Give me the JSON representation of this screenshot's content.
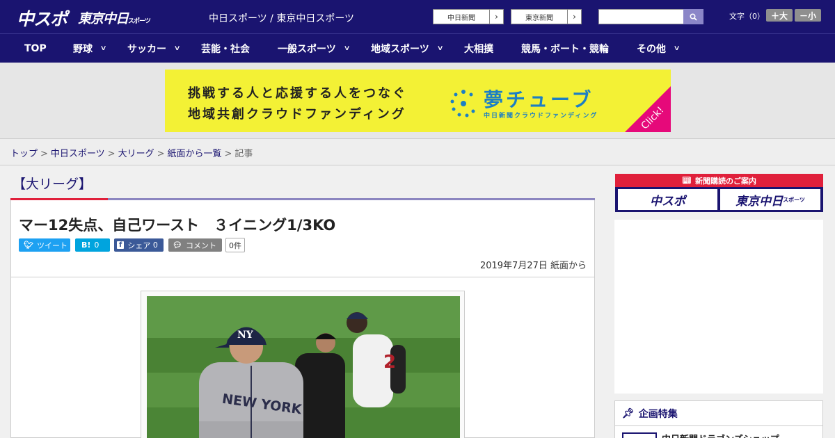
{
  "header": {
    "logo_chuspo": "中スポ",
    "logo_tokyo": "東京中日",
    "logo_tokyo_sub": "スポーツ",
    "site_links": "中日スポーツ / 東京中日スポーツ",
    "paper1": "中日新聞",
    "paper2": "東京新聞",
    "font_size_label": "文字（0）",
    "font_plus": "＋大",
    "font_minus": "－小"
  },
  "nav": {
    "items": [
      {
        "label": "TOP"
      },
      {
        "label": "野球"
      },
      {
        "label": "サッカー"
      },
      {
        "label": "芸能・社会"
      },
      {
        "label": "一般スポーツ"
      },
      {
        "label": "地域スポーツ"
      },
      {
        "label": "大相撲"
      },
      {
        "label": "競馬・ボート・競輪"
      },
      {
        "label": "その他"
      }
    ]
  },
  "banner": {
    "line1": "挑戦する人と応援する人をつなぐ",
    "line2": "地域共創クラウドファンディング",
    "brand": "夢チューブ",
    "sub": "中日新聞クラウドファンディング",
    "click": "Click!",
    "accent_color": "#e6097a"
  },
  "breadcrumb": {
    "items": [
      "トップ",
      "中日スポーツ",
      "大リーグ",
      "紙面から一覧"
    ],
    "current": "記事"
  },
  "article": {
    "category": "【大リーグ】",
    "title": "マー12失点、自己ワースト　３イニング1/3KO",
    "tweet": "ツイート",
    "hatena_count": "0",
    "share_label": "シェア",
    "share_count": "0",
    "comment_label": "コメント",
    "comment_count": "0件",
    "date": "2019年7月27日 紙面から",
    "photo_jersey_text": "NEW YORK",
    "photo_runner_number": "2"
  },
  "sidebar": {
    "subscribe_head": "新聞購読のご案内",
    "sub_logo1": "中スポ",
    "sub_logo2": "東京中日",
    "sub_logo2_sub": "スポーツ",
    "feature_title": "企画特集",
    "feature_item": "中日新聞ドラゴンズショップ"
  }
}
